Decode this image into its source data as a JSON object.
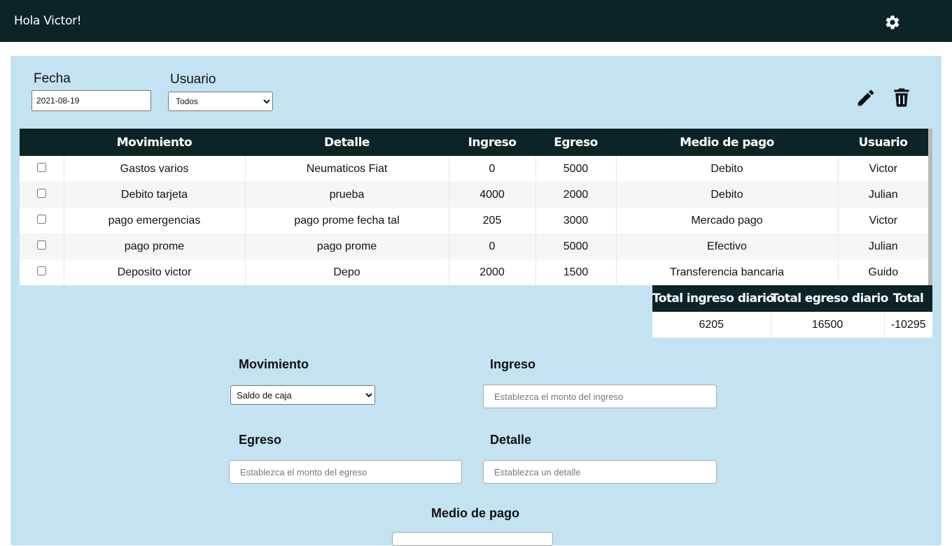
{
  "header": {
    "greeting": "Hola Victor!",
    "settings_icon": "gear-icon"
  },
  "filters": {
    "fecha_label": "Fecha",
    "fecha_value": "2021-08-19",
    "usuario_label": "Usuario",
    "usuario_selected": "Todos"
  },
  "actions": {
    "edit_icon": "pencil-icon",
    "delete_icon": "trash-icon"
  },
  "table": {
    "columns": [
      "",
      "Movimiento",
      "Detalle",
      "Ingreso",
      "Egreso",
      "Medio de pago",
      "Usuario"
    ],
    "rows": [
      {
        "movimiento": "Gastos varios",
        "detalle": "Neumaticos Fiat",
        "ingreso": "0",
        "egreso": "5000",
        "medio": "Debito",
        "usuario": "Victor"
      },
      {
        "movimiento": "Debito tarjeta",
        "detalle": "prueba",
        "ingreso": "4000",
        "egreso": "2000",
        "medio": "Debito",
        "usuario": "Julian"
      },
      {
        "movimiento": "pago emergencias",
        "detalle": "pago prome fecha tal",
        "ingreso": "205",
        "egreso": "3000",
        "medio": "Mercado pago",
        "usuario": "Victor"
      },
      {
        "movimiento": "pago prome",
        "detalle": "pago prome",
        "ingreso": "0",
        "egreso": "5000",
        "medio": "Efectivo",
        "usuario": "Julian"
      },
      {
        "movimiento": "Deposito victor",
        "detalle": "Depo",
        "ingreso": "2000",
        "egreso": "1500",
        "medio": "Transferencia bancaria",
        "usuario": "Guido"
      }
    ]
  },
  "totals": {
    "headers": [
      "Total ingreso diario",
      "Total egreso diario",
      "Total"
    ],
    "values": [
      "6205",
      "16500",
      "-10295"
    ]
  },
  "form": {
    "movimiento_label": "Movimiento",
    "movimiento_selected": "Saldo de caja",
    "ingreso_label": "Ingreso",
    "ingreso_placeholder": "Establezca el monto del ingreso",
    "egreso_label": "Egreso",
    "egreso_placeholder": "Establezca el monto del egreso",
    "detalle_label": "Detalle",
    "detalle_placeholder": "Establezca un detalle",
    "medio_label": "Medio de pago"
  },
  "colors": {
    "header_bg": "#0d2427",
    "panel_bg": "#c3e3f2"
  }
}
